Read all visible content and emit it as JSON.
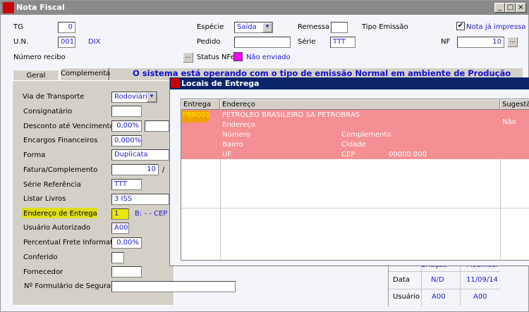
{
  "window": {
    "title": "Nota Fiscal"
  },
  "header": {
    "tg_label": "TG",
    "tg_value": "0",
    "un_label": "U.N.",
    "un_value": "001",
    "un_desc": "DIX",
    "numero_recibo_label": "Número recibo",
    "especie_label": "Espécie",
    "especie_value": "Saída",
    "pedido_label": "Pedido",
    "pedido_value": "",
    "status_label": "Status NFe",
    "status_value": "Não enviado",
    "status_color": "#ff00ff",
    "remessa_label": "Remessa",
    "remessa_value": "",
    "serie_label": "Série",
    "serie_value": "TTT",
    "tipo_emissao_label": "Tipo Emissão",
    "nota_impressa_label": "Nota já impressa",
    "nota_impressa_checked": true,
    "nf_label": "NF",
    "nf_value": "10",
    "ellipsis": "..."
  },
  "tabs": [
    {
      "label": "Geral"
    },
    {
      "label": "Complementar",
      "active": true
    }
  ],
  "banner": "O sistema está operando com o tipo de emissão Normal em ambiente de Produção",
  "form": {
    "via_transporte": {
      "label": "Via de Transporte",
      "value": "Rodoviária"
    },
    "consignatario": {
      "label": "Consignatário",
      "value": ""
    },
    "desconto": {
      "label": "Desconto até Vencimento",
      "value": "0,00%"
    },
    "encargos": {
      "label": "Encargos Financeiros",
      "value": "0,000%"
    },
    "forma": {
      "label": "Forma",
      "value": "Duplicata"
    },
    "fatura": {
      "label": "Fatura/Complemento",
      "value": "10",
      "sep": "/"
    },
    "serie_ref": {
      "label": "Série Referência",
      "value": "TTT"
    },
    "listar_livros": {
      "label": "Listar Livros",
      "value": "3 ISS"
    },
    "endereco_entrega": {
      "label": "Endereço de Entrega",
      "value": "1",
      "extra": "B:  -  -  CEP"
    },
    "usuario_autorizado": {
      "label": "Usuário Autorizado",
      "value": "A00"
    },
    "percentual_frete": {
      "label": "Percentual Frete Informativo",
      "value": "0,00%"
    },
    "conferido": {
      "label": "Conferido",
      "value": ""
    },
    "fornecedor": {
      "label": "Fornecedor",
      "value": ""
    },
    "formulario_seguranca": {
      "label": "Nº Formulário de Segurança",
      "value": ""
    }
  },
  "popup": {
    "title": "Locais de Entrega",
    "columns": [
      "Entrega",
      "Endereço",
      "Sugestão"
    ],
    "row": {
      "entrega": "PBR001",
      "nome": "PETROLEO BRASILEIRO SA PETROBRAS",
      "endereco": "Endereço",
      "numero": "Número",
      "complemento": "Complemento",
      "bairro": "Bairro",
      "cidade": "Cidade",
      "uf": "UF",
      "cep_label": "CEP",
      "cep": "00000.000",
      "sugestao": "Não"
    }
  },
  "audit": {
    "columns": [
      "Criação",
      "Modificar"
    ],
    "rows": [
      {
        "label": "Data",
        "criacao": "N/D",
        "modificar": "11/09/14"
      },
      {
        "label": "Usuário",
        "criacao": "A00",
        "modificar": "A00"
      }
    ]
  }
}
